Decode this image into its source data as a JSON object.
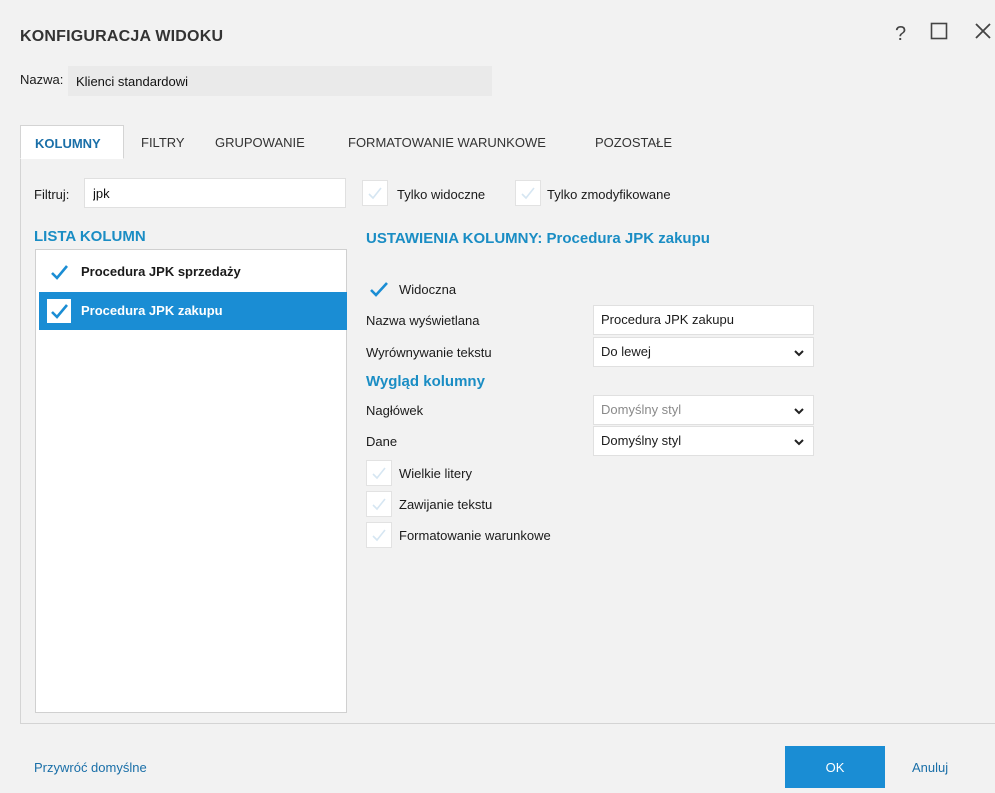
{
  "dialog": {
    "title": "KONFIGURACJA WIDOKU",
    "help_glyph": "?",
    "maximize_glyph": "☐",
    "close_glyph": "✕"
  },
  "name": {
    "label": "Nazwa:",
    "value": "Klienci standardowi"
  },
  "tabs": [
    {
      "label": "KOLUMNY",
      "active": true
    },
    {
      "label": "FILTRY"
    },
    {
      "label": "GRUPOWANIE"
    },
    {
      "label": "FORMATOWANIE WARUNKOWE"
    },
    {
      "label": "POZOSTAŁE"
    }
  ],
  "filter": {
    "label": "Filtruj:",
    "value": "jpk"
  },
  "toggles": {
    "only_visible": "Tylko widoczne",
    "only_modified": "Tylko zmodyfikowane"
  },
  "column_list": {
    "heading": "LISTA KOLUMN",
    "items": [
      {
        "label": "Procedura JPK sprzedaży",
        "checked": true,
        "selected": false
      },
      {
        "label": "Procedura JPK zakupu",
        "checked": true,
        "selected": true
      }
    ]
  },
  "settings": {
    "heading": "USTAWIENIA KOLUMNY: Procedura JPK zakupu",
    "visible_label": "Widoczna",
    "display_name_label": "Nazwa wyświetlana",
    "display_name_value": "Procedura JPK zakupu",
    "align_label": "Wyrównywanie tekstu",
    "align_value": "Do lewej",
    "appearance_heading": "Wygląd kolumny",
    "header_label": "Nagłówek",
    "header_value": "Domyślny styl",
    "data_label": "Dane",
    "data_value": "Domyślny styl",
    "uppercase_label": "Wielkie litery",
    "wrap_label": "Zawijanie tekstu",
    "cond_format_label": "Formatowanie warunkowe"
  },
  "footer": {
    "restore_label": "Przywróć domyślne",
    "ok_label": "OK",
    "cancel_label": "Anuluj"
  },
  "colors": {
    "accent": "#1a8dd4",
    "link": "#1a6fa8",
    "heading": "#1a8dc4"
  }
}
